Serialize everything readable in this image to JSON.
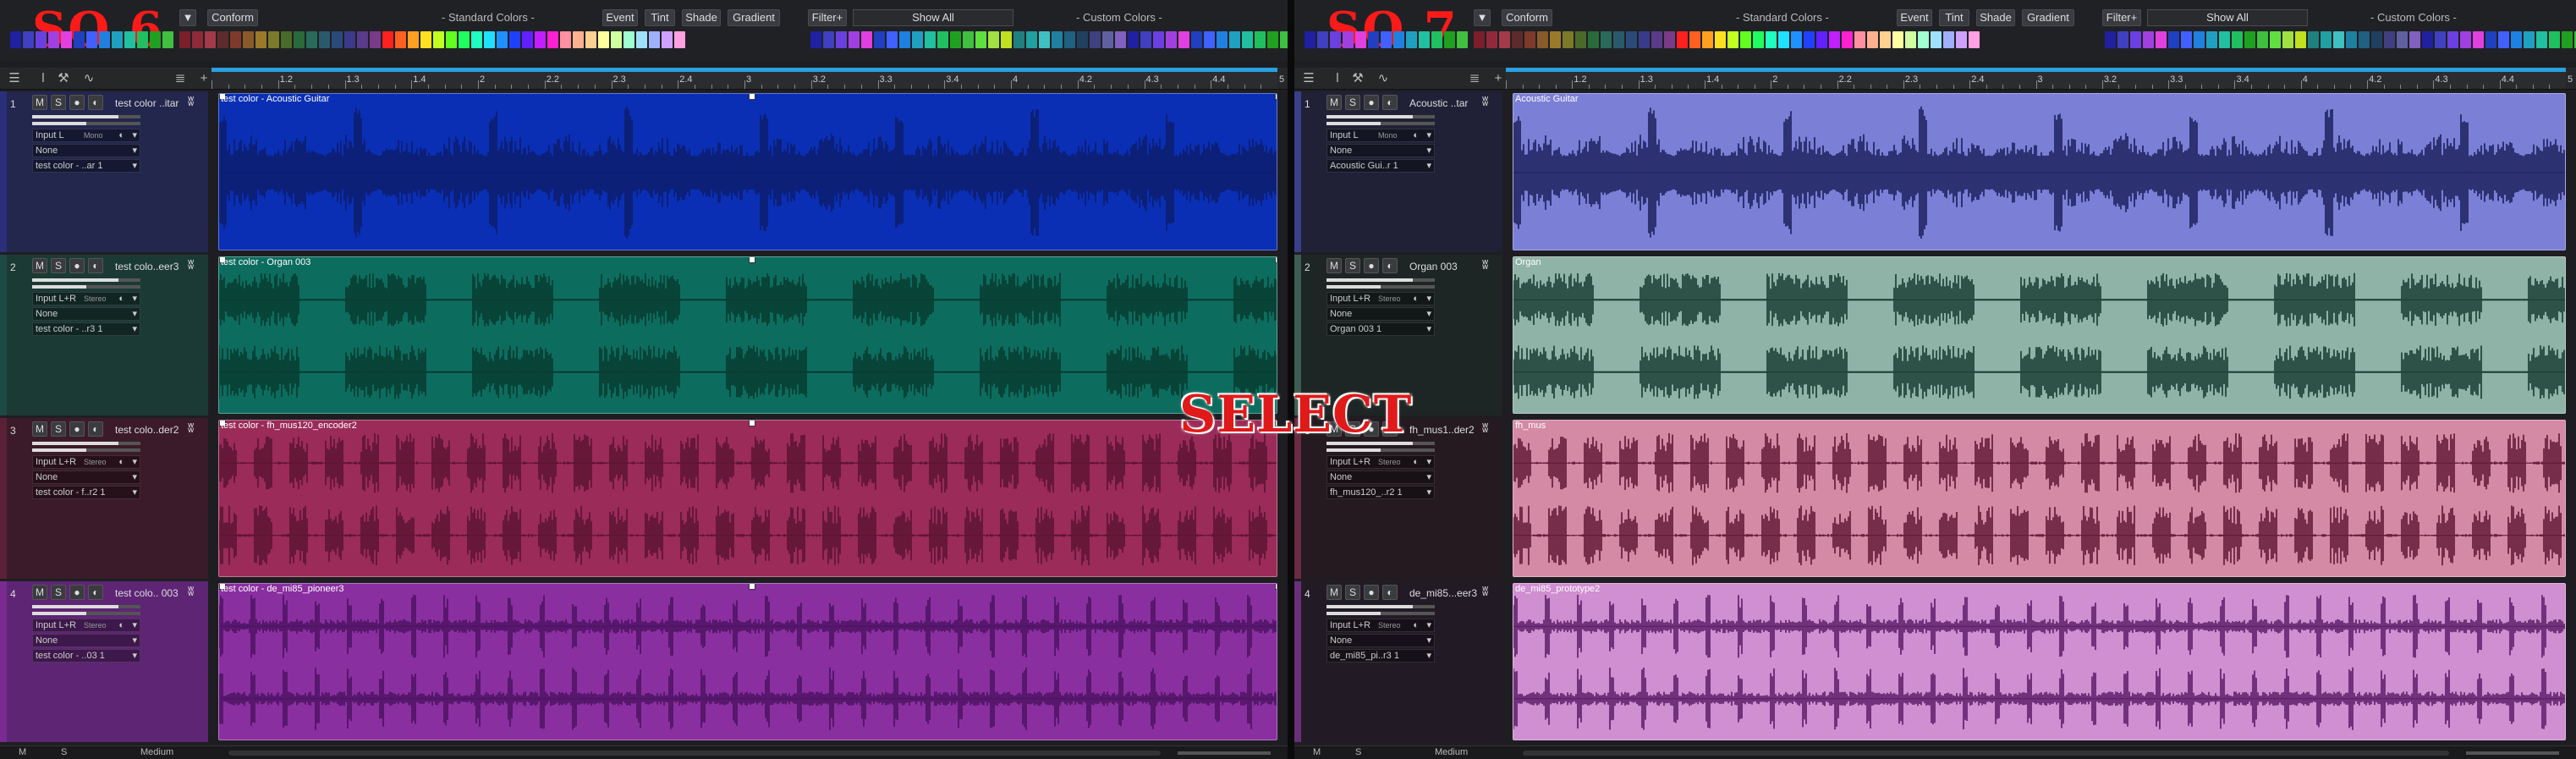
{
  "overlay_text": "SELECT",
  "colors": {
    "palette": [
      "#7a1f2b",
      "#8f2a3a",
      "#a33a4a",
      "#5e2b2b",
      "#7d3a2a",
      "#8a5a2a",
      "#9a7a2a",
      "#7a7a2a",
      "#4a6a2a",
      "#2a6a3a",
      "#2a6a5a",
      "#2a5a6a",
      "#2a4a7a",
      "#3a3a8a",
      "#5a3a8a",
      "#7a3a8a",
      "#ff2020",
      "#ff6020",
      "#ffa020",
      "#ffe020",
      "#c0ff20",
      "#60ff20",
      "#20ff60",
      "#20ffc0",
      "#20e0ff",
      "#2090ff",
      "#2040ff",
      "#6020ff",
      "#c020ff",
      "#ff20d0",
      "#ff90a0",
      "#ffb090",
      "#ffd090",
      "#ffffa0",
      "#d0ffa0",
      "#a0ffd0",
      "#a0e0ff",
      "#a0b0ff",
      "#d0a0ff",
      "#ffa0e0"
    ],
    "custom": [
      "#2020a0",
      "#4040c0",
      "#6a40e0",
      "#a040e0",
      "#e040e0",
      "#2040c0",
      "#4060ff",
      "#2080e0",
      "#20a0c0",
      "#20c0a0",
      "#20c060",
      "#20a020",
      "#40c040",
      "#60e040",
      "#a0e040",
      "#c0e020",
      "#208080",
      "#20a0a0",
      "#40c0c0",
      "#2080a0",
      "#206080",
      "#204060",
      "#404080",
      "#6060a0",
      "#8060c0"
    ]
  },
  "panels": [
    {
      "id": "so6",
      "logo": "SO 6",
      "toolbar": {
        "conform": "Conform",
        "standard_colors": "- Standard Colors -",
        "event": "Event",
        "tint": "Tint",
        "shade": "Shade",
        "gradient": "Gradient",
        "filter": "Filter+",
        "show_all": "Show All",
        "custom_colors": "- Custom Colors -"
      },
      "ruler": [
        "1.2",
        "1.3",
        "1.4",
        "2",
        "2.2",
        "2.3",
        "2.4",
        "3",
        "3.2",
        "3.3",
        "3.4",
        "4",
        "4.2",
        "4.3",
        "4.4",
        "5"
      ],
      "tracks": [
        {
          "num": "1",
          "name": "test color ..itar",
          "input": "Input L",
          "mode": "Mono",
          "none": "None",
          "out": "test color - ..ar 1",
          "event": "test color - Acoustic Guitar",
          "color": "#0a2fb5",
          "track_color": "#2b2f7a",
          "wave": "#0c1d6a",
          "panel_bg": "#23264d"
        },
        {
          "num": "2",
          "name": "test colo..eer3",
          "input": "Input L+R",
          "mode": "Stereo",
          "none": "None",
          "out": "test color - ..r3 1",
          "event": "test color - Organ 003",
          "color": "#0c6d5f",
          "track_color": "#1d4a44",
          "wave": "#08392f",
          "panel_bg": "#1b3a36"
        },
        {
          "num": "3",
          "name": "test colo..der2",
          "input": "Input L+R",
          "mode": "Stereo",
          "none": "None",
          "out": "test color - f..r2 1",
          "event": "test color - fh_mus120_encoder2",
          "color": "#9b2b58",
          "track_color": "#5a2036",
          "wave": "#5a1430",
          "panel_bg": "#3b1b29"
        },
        {
          "num": "4",
          "name": "test colo.. 003",
          "input": "Input L+R",
          "mode": "Stereo",
          "none": "None",
          "out": "test color - ..03 1",
          "event": "test color - de_mi85_pioneer3",
          "color": "#8a2fa0",
          "track_color": "#7a2a90",
          "wave": "#4a1260",
          "panel_bg": "#5e2574"
        }
      ],
      "bottom": {
        "m": "M",
        "s": "S",
        "zoom": "Medium"
      }
    },
    {
      "id": "so7",
      "logo": "SO 7",
      "toolbar": {
        "conform": "Conform",
        "standard_colors": "- Standard Colors -",
        "event": "Event",
        "tint": "Tint",
        "shade": "Shade",
        "gradient": "Gradient",
        "filter": "Filter+",
        "show_all": "Show All",
        "custom_colors": "- Custom Colors -"
      },
      "ruler": [
        "1.2",
        "1.3",
        "1.4",
        "2",
        "2.2",
        "2.3",
        "2.4",
        "3",
        "3.2",
        "3.3",
        "3.4",
        "4",
        "4.2",
        "4.3",
        "4.4",
        "5"
      ],
      "tracks": [
        {
          "num": "1",
          "name": "Acoustic ..tar",
          "input": "Input L",
          "mode": "Mono",
          "none": "None",
          "out": "Acoustic Gui..r 1",
          "event": "Acoustic Guitar",
          "color": "#7b7fd6",
          "track_color": "#3a3f8a",
          "wave": "#1a1e5a",
          "panel_bg": "#202136"
        },
        {
          "num": "2",
          "name": "Organ 003",
          "input": "Input L+R",
          "mode": "Stereo",
          "none": "None",
          "out": "Organ 003  1",
          "event": "Organ",
          "color": "#8fb3a6",
          "track_color": "#3d5c53",
          "wave": "#163a30",
          "panel_bg": "#1d2624"
        },
        {
          "num": "3",
          "name": "fh_mus1..der2",
          "input": "Input L+R",
          "mode": "Stereo",
          "none": "None",
          "out": "fh_mus120_..r2 1",
          "event": "fh_mus",
          "color": "#d48aa5",
          "track_color": "#6a2a44",
          "wave": "#5e1633",
          "panel_bg": "#241a1f"
        },
        {
          "num": "4",
          "name": "de_mi85...eer3",
          "input": "Input L+R",
          "mode": "Stereo",
          "none": "None",
          "out": "de_mi85_pi..r3 1",
          "event": "de_mi85_prototype2",
          "color": "#cf8fd0",
          "track_color": "#6a2f7a",
          "wave": "#5a1a66",
          "panel_bg": "#221b26"
        }
      ],
      "bottom": {
        "m": "M",
        "s": "S",
        "zoom": "Medium"
      }
    }
  ]
}
